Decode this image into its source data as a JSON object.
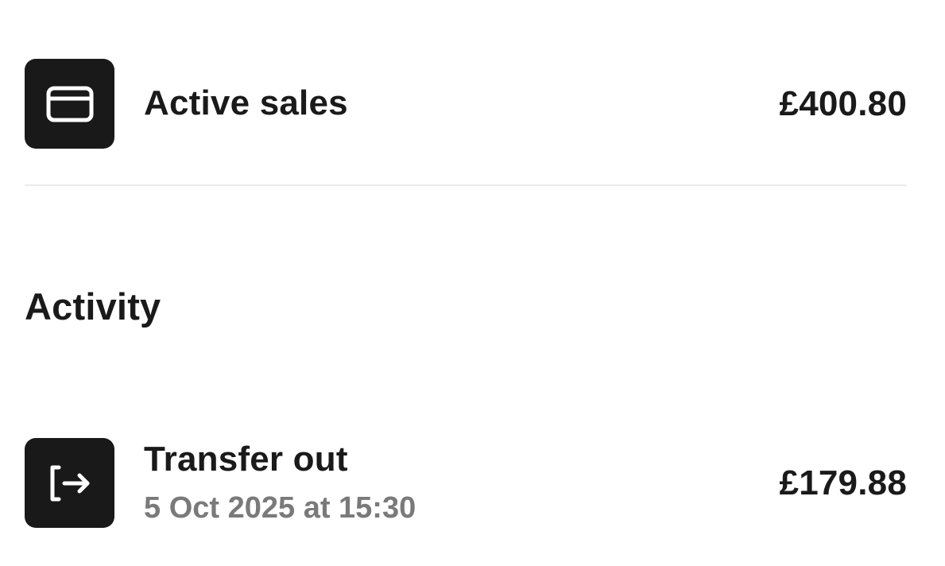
{
  "summary": {
    "active_sales": {
      "icon": "card-icon",
      "label": "Active sales",
      "amount": "£400.80"
    }
  },
  "activity": {
    "title": "Activity",
    "items": [
      {
        "icon": "transfer-out-icon",
        "title": "Transfer out",
        "timestamp": "5 Oct 2025 at 15:30",
        "amount": "£179.88"
      }
    ]
  },
  "colors": {
    "tile_background": "#191919",
    "text_primary": "#1a1a1a",
    "text_secondary": "#7a7a7a",
    "divider": "#ececec"
  }
}
